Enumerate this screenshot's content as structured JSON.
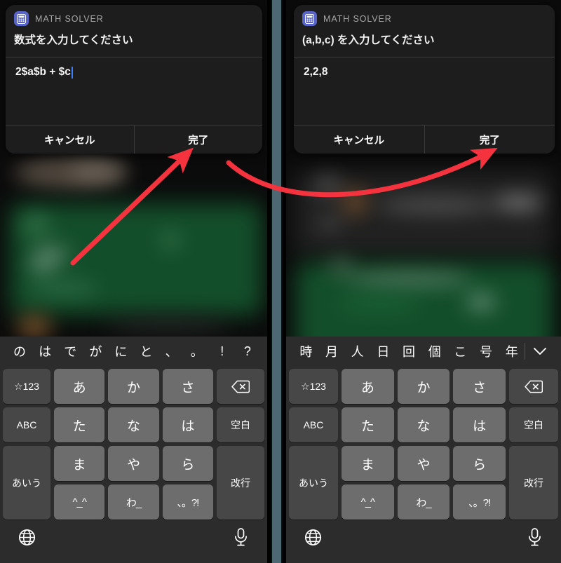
{
  "panels": [
    {
      "id": "left",
      "dialog": {
        "app_icon": "calculator-icon",
        "app_name": "MATH SOLVER",
        "prompt": "数式を入力してください",
        "value": "2$a$b + $c",
        "has_caret": true,
        "cancel_label": "キャンセル",
        "done_label": "完了"
      },
      "keyboard": {
        "suggestions": [
          "の",
          "は",
          "で",
          "が",
          "に",
          "と",
          "、",
          "。",
          "!",
          "?"
        ],
        "has_chevron": false,
        "rows": [
          {
            "side_left": "☆123",
            "chars": [
              "あ",
              "か",
              "さ"
            ],
            "side_right": "delete-icon"
          },
          {
            "side_left": "ABC",
            "chars": [
              "た",
              "な",
              "は"
            ],
            "side_right": "空白"
          },
          {
            "side_left": "あいう",
            "chars": [
              "ま",
              "や",
              "ら"
            ],
            "chars2": [
              "^_^",
              "わ_",
              "、。?!"
            ],
            "side_right": "改行"
          }
        ],
        "globe_icon": "globe-icon",
        "mic_icon": "microphone-icon"
      }
    },
    {
      "id": "right",
      "dialog": {
        "app_icon": "calculator-icon",
        "app_name": "MATH SOLVER",
        "prompt": "(a,b,c) を入力してください",
        "value": "2,2,8",
        "has_caret": false,
        "cancel_label": "キャンセル",
        "done_label": "完了"
      },
      "keyboard": {
        "suggestions": [
          "時",
          "月",
          "人",
          "日",
          "回",
          "個",
          "こ",
          "号",
          "年"
        ],
        "has_chevron": true,
        "rows": [
          {
            "side_left": "☆123",
            "chars": [
              "あ",
              "か",
              "さ"
            ],
            "side_right": "delete-icon"
          },
          {
            "side_left": "ABC",
            "chars": [
              "た",
              "な",
              "は"
            ],
            "side_right": "空白"
          },
          {
            "side_left": "あいう",
            "chars": [
              "ま",
              "や",
              "ら"
            ],
            "chars2": [
              "^_^",
              "わ_",
              "、。?!"
            ],
            "side_right": "改行"
          }
        ],
        "globe_icon": "globe-icon",
        "mic_icon": "microphone-icon"
      }
    }
  ],
  "annotations": {
    "arrow_color": "#f5333f",
    "arrow_1": "straight arrow pointing to left panel 完了 button",
    "arrow_2": "curved arrow from left panel 完了 to right panel 完了 button"
  },
  "colors": {
    "app_icon_bg": "#5864c8",
    "dialog_bg": "#1d1d1d",
    "keyboard_bg": "#2c2c2c",
    "key_bg": "#6d6d6d",
    "key_fn_bg": "#474747",
    "caret": "#3e7dff",
    "divider": "#4d6872",
    "arrow": "#f5333f"
  }
}
